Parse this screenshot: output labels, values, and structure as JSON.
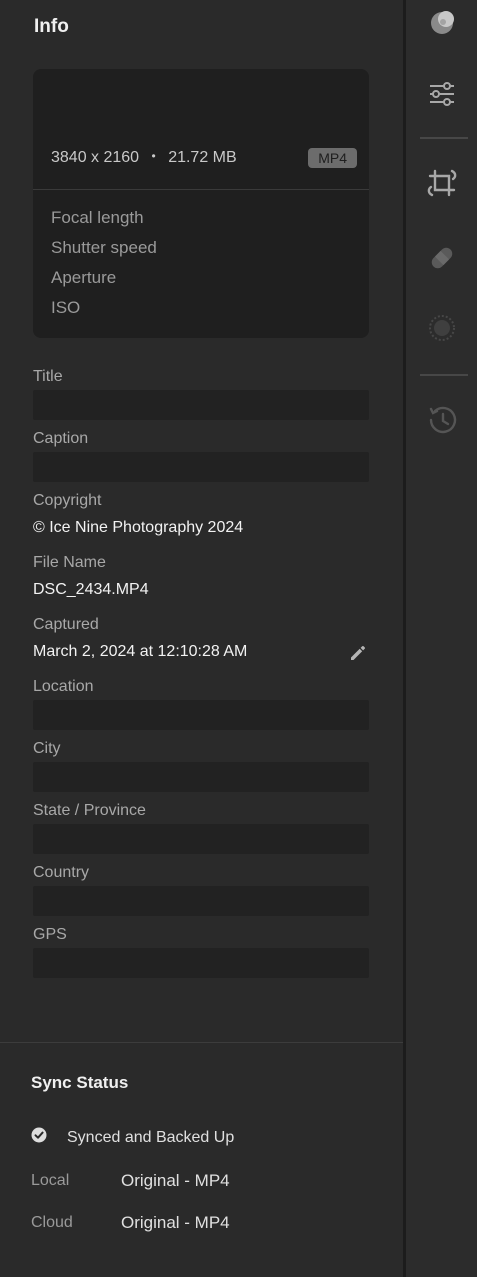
{
  "info": {
    "heading": "Info",
    "dimensions": "3840 x 2160",
    "separator": "•",
    "file_size": "21.72 MB",
    "format_badge": "MP4",
    "exif_labels": [
      "Focal length",
      "Shutter speed",
      "Aperture",
      "ISO"
    ]
  },
  "fields": {
    "title": {
      "label": "Title",
      "value": ""
    },
    "caption": {
      "label": "Caption",
      "value": ""
    },
    "copyright": {
      "label": "Copyright",
      "value": "© Ice Nine Photography 2024"
    },
    "file_name": {
      "label": "File Name",
      "value": "DSC_2434.MP4"
    },
    "captured": {
      "label": "Captured",
      "value": "March 2, 2024 at 12:10:28 AM"
    },
    "location": {
      "label": "Location",
      "value": ""
    },
    "city": {
      "label": "City",
      "value": ""
    },
    "state": {
      "label": "State / Province",
      "value": ""
    },
    "country": {
      "label": "Country",
      "value": ""
    },
    "gps": {
      "label": "GPS",
      "value": ""
    }
  },
  "sync": {
    "heading": "Sync Status",
    "status": "Synced and Backed Up",
    "local_label": "Local",
    "local_value": "Original - MP4",
    "cloud_label": "Cloud",
    "cloud_value": "Original - MP4"
  },
  "rail_icons": [
    "presets-icon",
    "edit-sliders-icon",
    "crop-icon",
    "healing-icon",
    "masking-icon",
    "history-icon"
  ],
  "colors": {
    "panel_bg": "#2a2a2a",
    "card_bg": "#1f1f1f",
    "field_bg": "#222222",
    "badge_bg": "#6c6c6c"
  }
}
